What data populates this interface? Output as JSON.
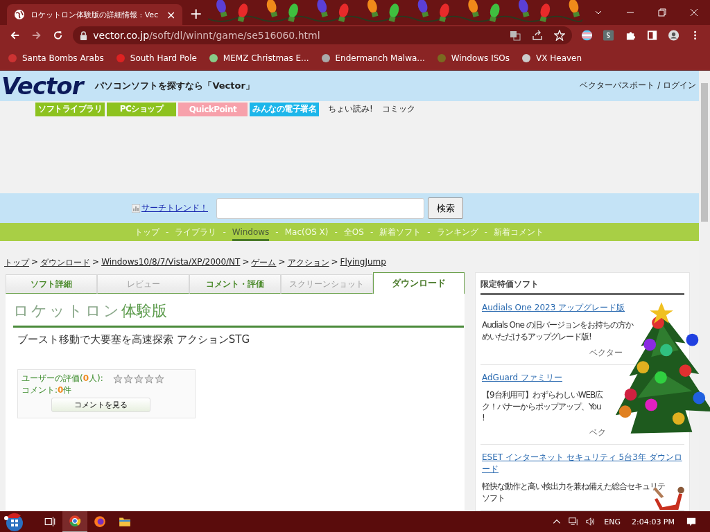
{
  "browser": {
    "tab": {
      "title": "ロケットロン体験版の詳細情報 : Vec",
      "close": "×"
    },
    "new_tab": "+",
    "url": {
      "host": "vector.co.jp",
      "path": "/soft/dl/winnt/game/se516060.html"
    },
    "bookmarks": [
      {
        "label": "Santa Bombs Arabs"
      },
      {
        "label": "South Hard Pole"
      },
      {
        "label": "MEMZ Christmas E..."
      },
      {
        "label": "Endermanch Malwa..."
      },
      {
        "label": "Windows ISOs"
      },
      {
        "label": "VX Heaven"
      }
    ]
  },
  "header": {
    "logo": "Vector",
    "tagline": "パソコンソフトを探すなら「Vector」",
    "login": "ベクターパスポート / ログイン"
  },
  "service_buttons": [
    {
      "label": "ソフトライブラリ",
      "color": "#8dc21f"
    },
    {
      "label": "PCショップ",
      "color": "#8dc21f"
    },
    {
      "label": "QuickPoint",
      "color": "#f7a1ab"
    },
    {
      "label": "みんなの電子署名",
      "color": "#1db6ea"
    }
  ],
  "service_links": [
    "ちょい読み!",
    "コミック"
  ],
  "search": {
    "trend_link": "サーチトレンド！",
    "button": "検索"
  },
  "nav": {
    "separator": "-",
    "items": [
      {
        "label": "トップ",
        "selected": false
      },
      {
        "label": "ライブラリ",
        "selected": false
      },
      {
        "label": "Windows",
        "selected": true
      },
      {
        "label": "Mac(OS X)",
        "selected": false
      },
      {
        "label": "全OS",
        "selected": false
      },
      {
        "label": "新着ソフト",
        "selected": false
      },
      {
        "label": "ランキング",
        "selected": false
      },
      {
        "label": "新着コメント",
        "selected": false
      }
    ]
  },
  "breadcrumb": {
    "separator": ">",
    "items": [
      "トップ",
      "ダウンロード",
      "Windows10/8/7/Vista/XP/2000/NT",
      "ゲーム",
      "アクション",
      "FlyingJump"
    ]
  },
  "tabs": [
    {
      "label": "ソフト詳細",
      "selected": false,
      "disabled": false
    },
    {
      "label": "レビュー",
      "selected": false,
      "disabled": true
    },
    {
      "label": "コメント・評価",
      "selected": false,
      "disabled": false
    },
    {
      "label": "スクリーンショット",
      "selected": false,
      "disabled": true
    },
    {
      "label": "ダウンロード",
      "selected": true,
      "disabled": false
    }
  ],
  "title": {
    "name": "ロケットロン",
    "edition": "体験版"
  },
  "catch": "ブースト移動で大要塞を高速探索 アクションSTG",
  "rating": {
    "label": "ユーザーの評価(",
    "count": "0",
    "label_end": "人):",
    "stars": 0,
    "comment_label": "コメント:",
    "comment_count": "0",
    "comment_unit": "件",
    "button": "コメントを見る"
  },
  "sidebar": {
    "title": "限定特価ソフト",
    "items": [
      {
        "title": "Audials One 2023 アップグレード版",
        "desc": [
          "Audials One の旧バージョンをお持ちの方か",
          "めいただけるアップグレード版!"
        ],
        "footer": "ベクター"
      },
      {
        "title": "AdGuard ファミリー",
        "desc": [
          "【9台利用可】わずらわしいWEB広",
          "ク！バナーからポップアップ、You",
          "!"
        ],
        "footer": "ベク"
      },
      {
        "title": "ESET インターネット セキュリティ 5台3年 ダウンロード",
        "desc": [
          "軽快な動作と高い検出力を兼ね備えた総合セキュリテ",
          "ソフト"
        ]
      }
    ]
  },
  "taskbar": {
    "language": "ENG",
    "time": "2:04:03 PM"
  }
}
